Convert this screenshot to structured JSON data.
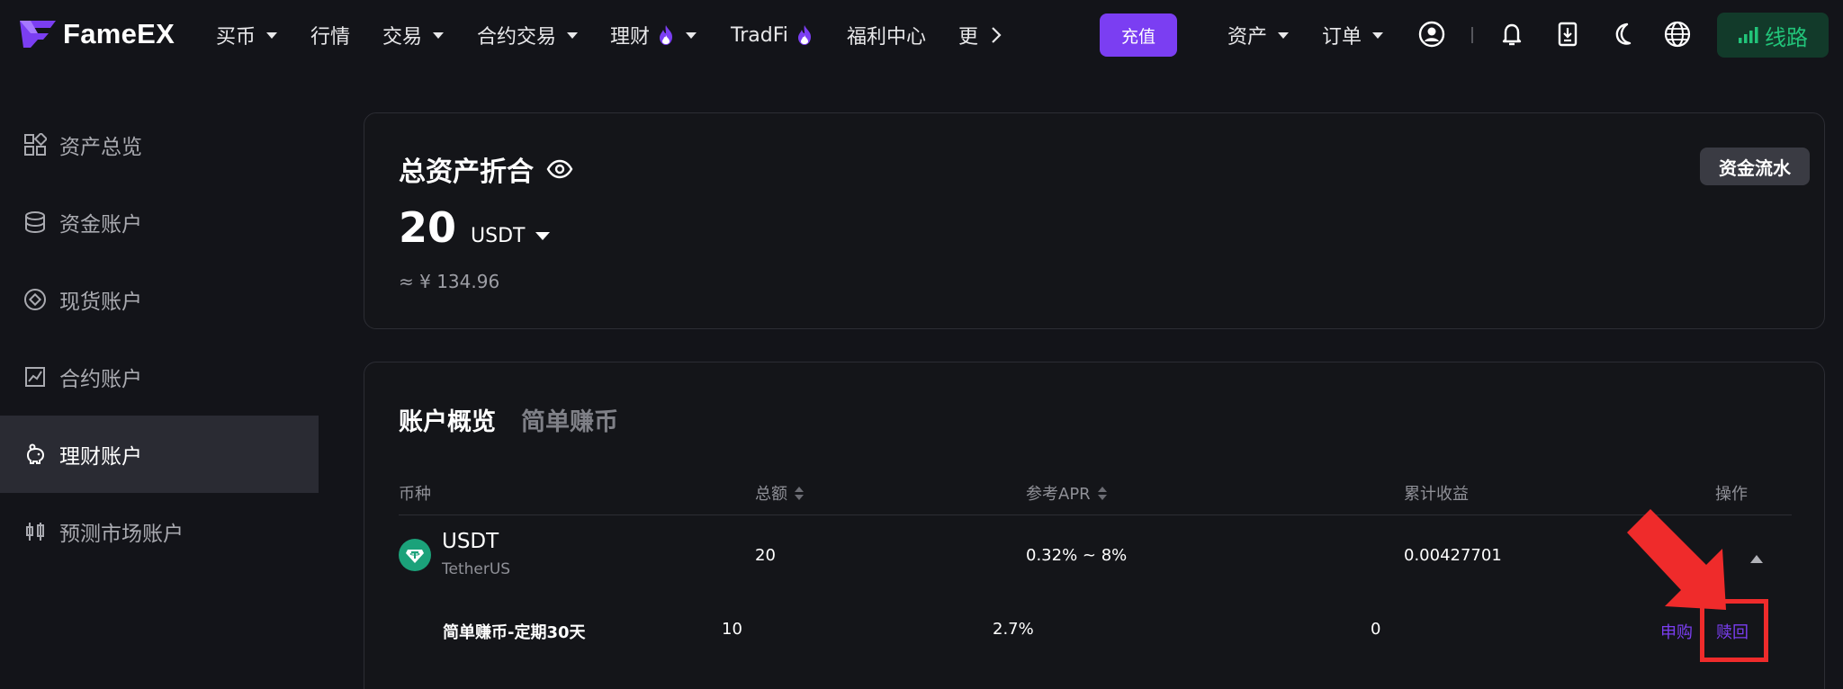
{
  "nav": {
    "brand": "FameEX",
    "items": [
      {
        "label": "买币",
        "has_caret": true
      },
      {
        "label": "行情"
      },
      {
        "label": "交易",
        "has_caret": true
      },
      {
        "label": "合约交易",
        "has_caret": true
      },
      {
        "label": "理财",
        "has_caret": true,
        "fire": true
      },
      {
        "label": "TradFi",
        "fire": true
      },
      {
        "label": "福利中心"
      },
      {
        "label": "更"
      }
    ],
    "deposit": "充值",
    "assets": "资产",
    "orders": "订单",
    "line_label": "线路"
  },
  "sidebar": {
    "items": [
      {
        "label": "资产总览",
        "icon": "grid-icon"
      },
      {
        "label": "资金账户",
        "icon": "database-icon"
      },
      {
        "label": "现货账户",
        "icon": "target-icon"
      },
      {
        "label": "合约账户",
        "icon": "chart-icon"
      },
      {
        "label": "理财账户",
        "icon": "piggy-bank-icon",
        "active": true
      },
      {
        "label": "预测市场账户",
        "icon": "candlestick-icon"
      }
    ]
  },
  "overview": {
    "title": "总资产折合",
    "fund_flow": "资金流水",
    "balance": "20",
    "unit": "USDT",
    "cny": "≈ ¥ 134.96"
  },
  "account": {
    "tabs": [
      "账户概览",
      "简单赚币"
    ],
    "columns": [
      "币种",
      "总额",
      "参考APR",
      "累计收益",
      "操作"
    ],
    "coin": {
      "symbol": "USDT",
      "name": "TetherUS",
      "total": "20",
      "apr": "0.32% ~ 8%",
      "earnings": "0.00427701"
    },
    "sub": {
      "name": "简单赚币-定期30天",
      "total": "10",
      "apr": "2.7%",
      "earnings": "0",
      "subscribe": "申购",
      "redeem": "赎回"
    }
  },
  "colors": {
    "accent": "#7b3ef2",
    "green": "#22c47a",
    "highlight": "#ef2b2b"
  }
}
